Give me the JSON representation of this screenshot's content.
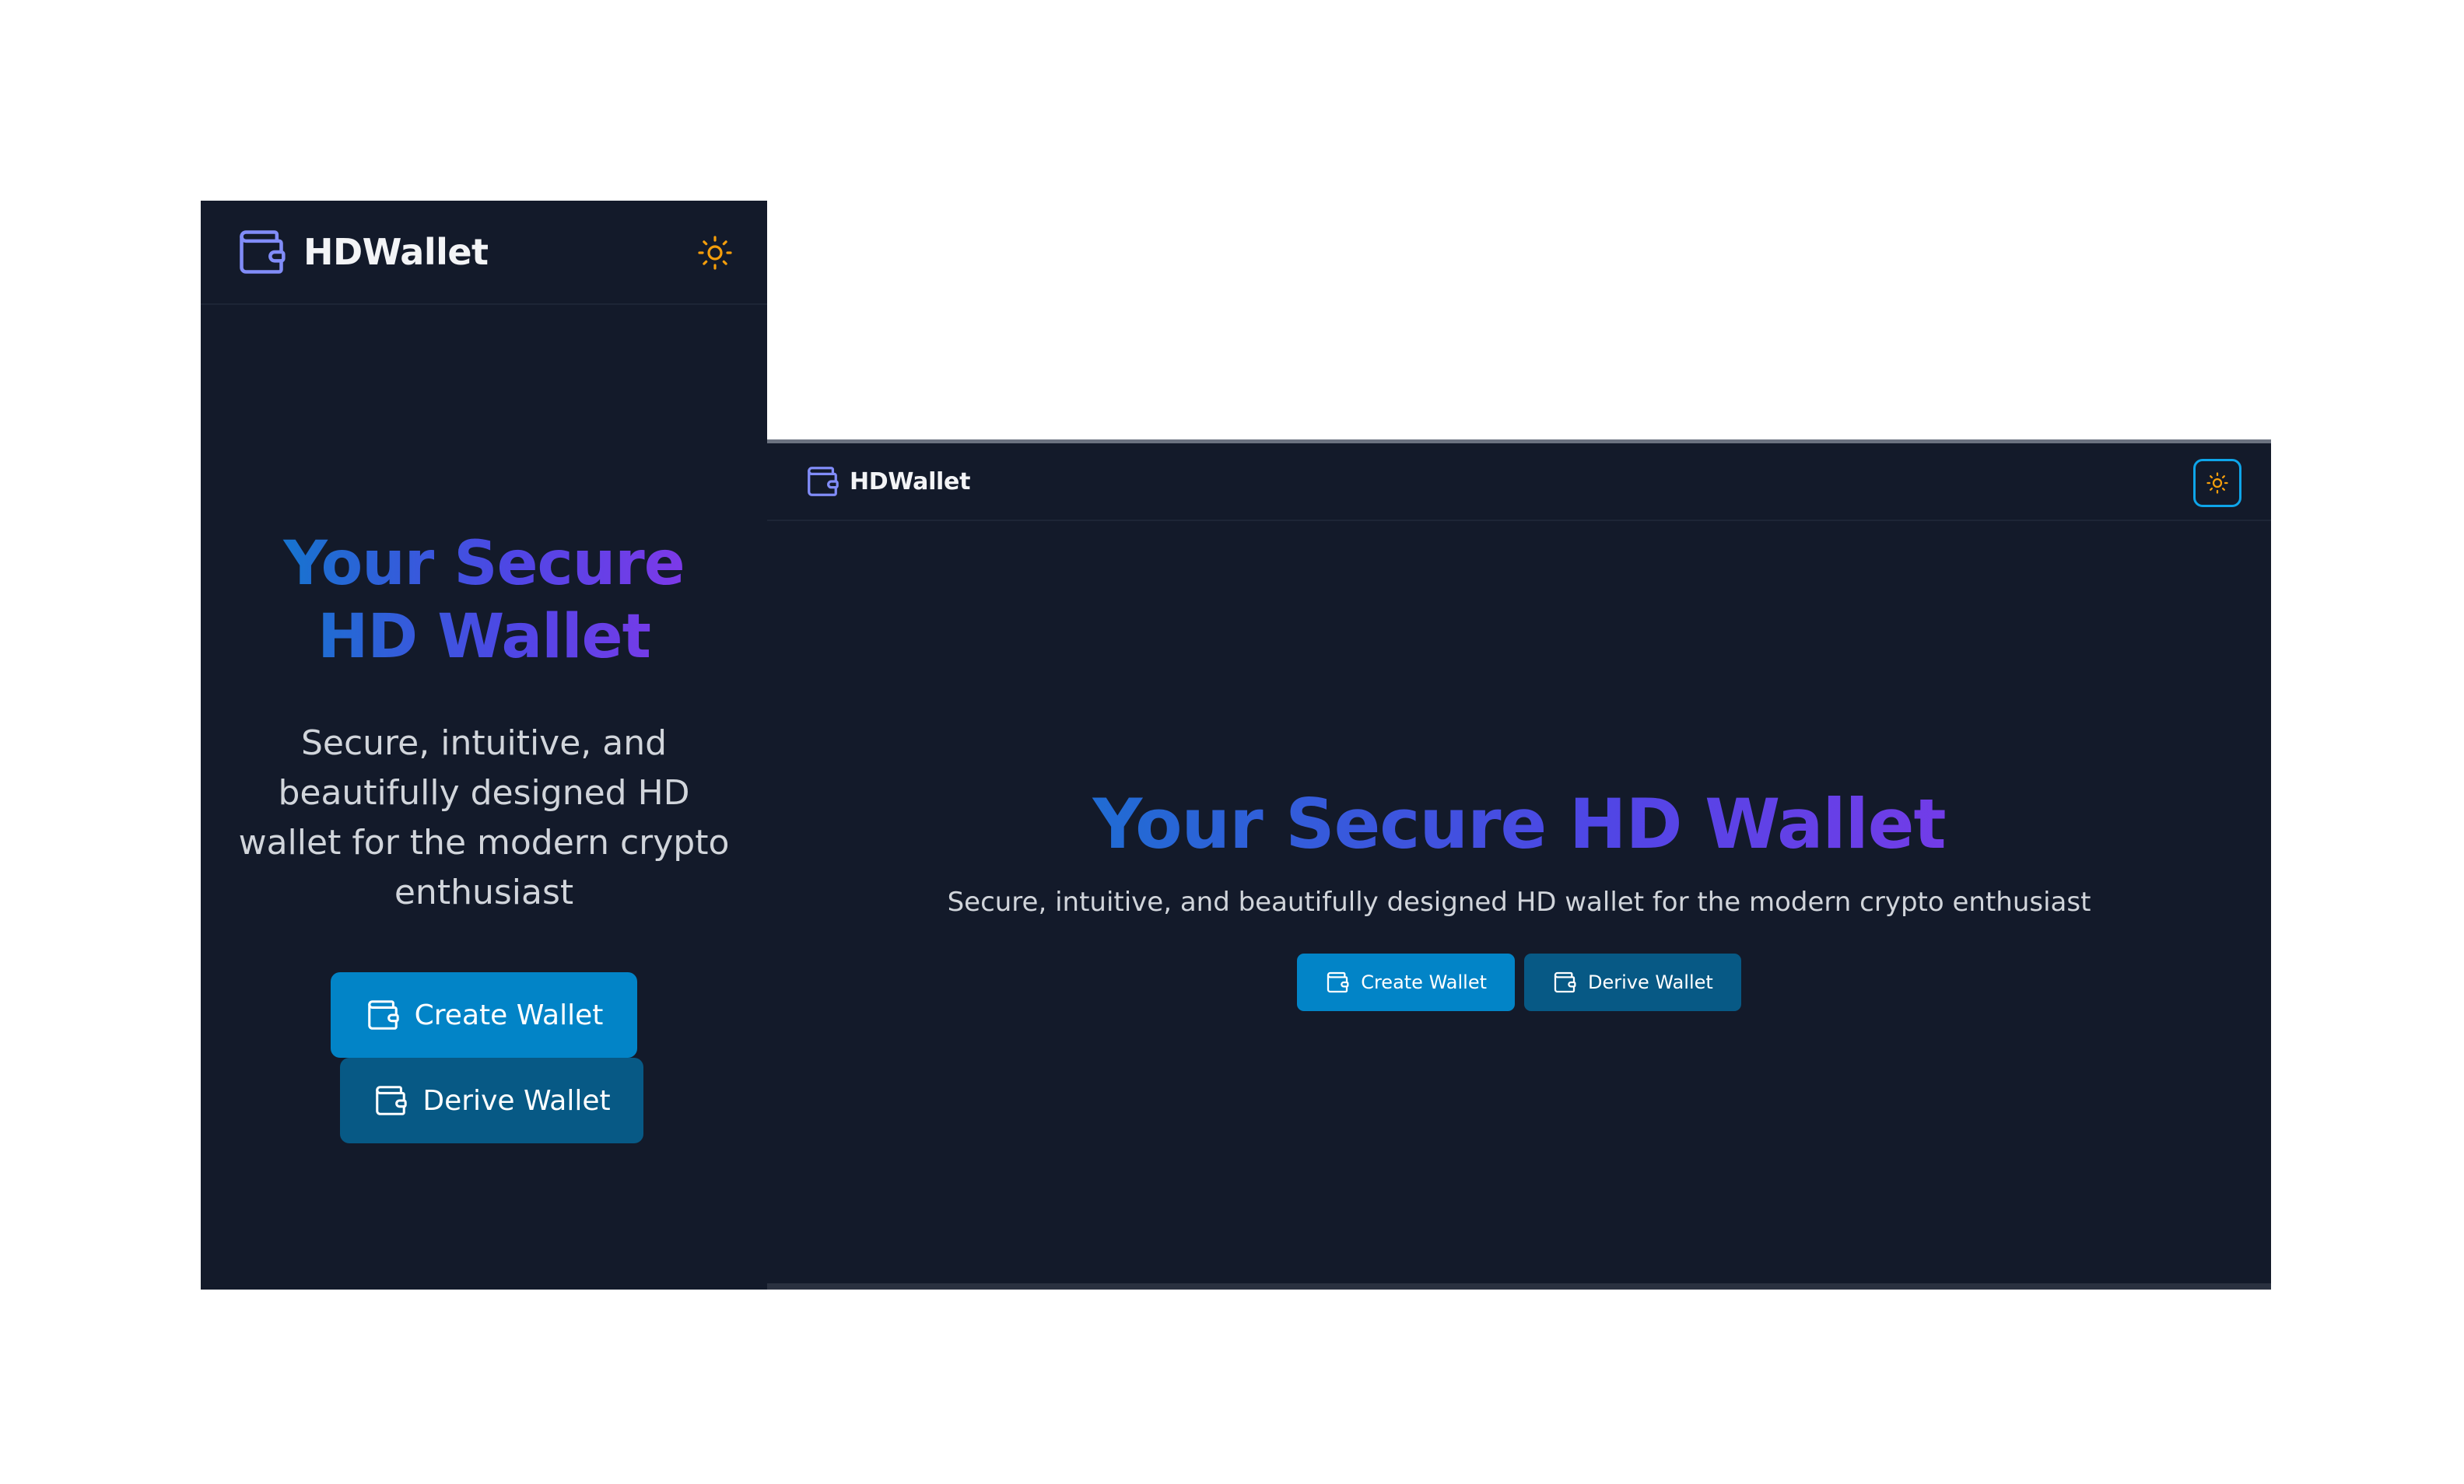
{
  "app": {
    "name": "HDWallet",
    "logo_icon": "wallet-icon",
    "theme_toggle_icon": "sun-icon"
  },
  "hero": {
    "title": "Your Secure HD Wallet",
    "subtitle": "Secure, intuitive, and beautifully designed HD wallet for the modern crypto enthusiast"
  },
  "actions": {
    "create_label": "Create Wallet",
    "derive_label": "Derive Wallet",
    "icon": "wallet-icon"
  },
  "colors": {
    "background": "#131a2a",
    "primary_button": "#0284c7",
    "secondary_button": "#075985",
    "logo": "#818cf8",
    "sun": "#f59e0b",
    "gradient": [
      "#0284c7",
      "#4f46e5",
      "#9333ea"
    ]
  }
}
